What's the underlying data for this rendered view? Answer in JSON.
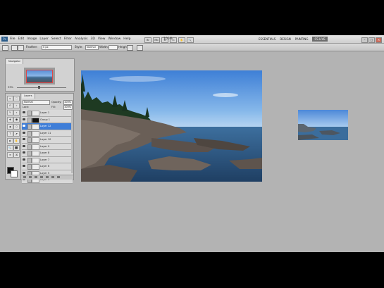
{
  "app": {
    "logo_text": "Ps"
  },
  "menu": {
    "items": [
      "File",
      "Edit",
      "Image",
      "Layer",
      "Select",
      "Filter",
      "Analysis",
      "3D",
      "View",
      "Window",
      "Help"
    ]
  },
  "menubar_tools": [
    "Br",
    "Mb",
    "≡",
    "▭",
    "✋",
    "🔍"
  ],
  "zoom": "100%",
  "workspaces": {
    "items": [
      "ESSENTIALS",
      "DESIGN",
      "PAINTING"
    ],
    "active": "CS LIVE"
  },
  "window_controls": [
    "–",
    "□",
    "×"
  ],
  "options_bar": {
    "feather_label": "Feather:",
    "feather_value": "0 px",
    "style_label": "Style:",
    "style_value": "Normal",
    "width_label": "Width:",
    "height_label": "Height:",
    "refine_label": "Refine Edge..."
  },
  "navigator": {
    "tab": "Navigator",
    "zoom": "33%"
  },
  "tools": [
    "▸",
    "⬚",
    "ʘ",
    "⌗",
    "✎",
    "⌖",
    "✚",
    "⬣",
    "◆",
    "⬡",
    "T",
    "⬈",
    "◐",
    "✋",
    "🔍",
    "⬛",
    "≡",
    "⌘"
  ],
  "layers": {
    "tab": "Layers",
    "blend_mode": "Normal",
    "opacity_label": "Opacity:",
    "opacity_value": "100%",
    "lock_label": "Lock:",
    "fill_label": "Fill:",
    "fill_value": "100%",
    "rows": [
      {
        "name": "Layer 1",
        "selected": false,
        "dark": false
      },
      {
        "name": "Group 1",
        "selected": false,
        "dark": true
      },
      {
        "name": "Layer 12",
        "selected": true,
        "dark": false
      },
      {
        "name": "Layer 11",
        "selected": false,
        "dark": false
      },
      {
        "name": "Layer 10",
        "selected": false,
        "dark": false
      },
      {
        "name": "Layer 9",
        "selected": false,
        "dark": false
      },
      {
        "name": "Layer 8",
        "selected": false,
        "dark": false
      },
      {
        "name": "Layer 7",
        "selected": false,
        "dark": false
      },
      {
        "name": "Layer 6",
        "selected": false,
        "dark": false
      },
      {
        "name": "Layer 5",
        "selected": false,
        "dark": false
      },
      {
        "name": "Layer 4",
        "selected": false,
        "dark": false
      }
    ]
  },
  "colors": {
    "selected_layer": "#3f7ed8",
    "canvas_bg": "#b3b3b3",
    "letterbox": "#000000"
  }
}
